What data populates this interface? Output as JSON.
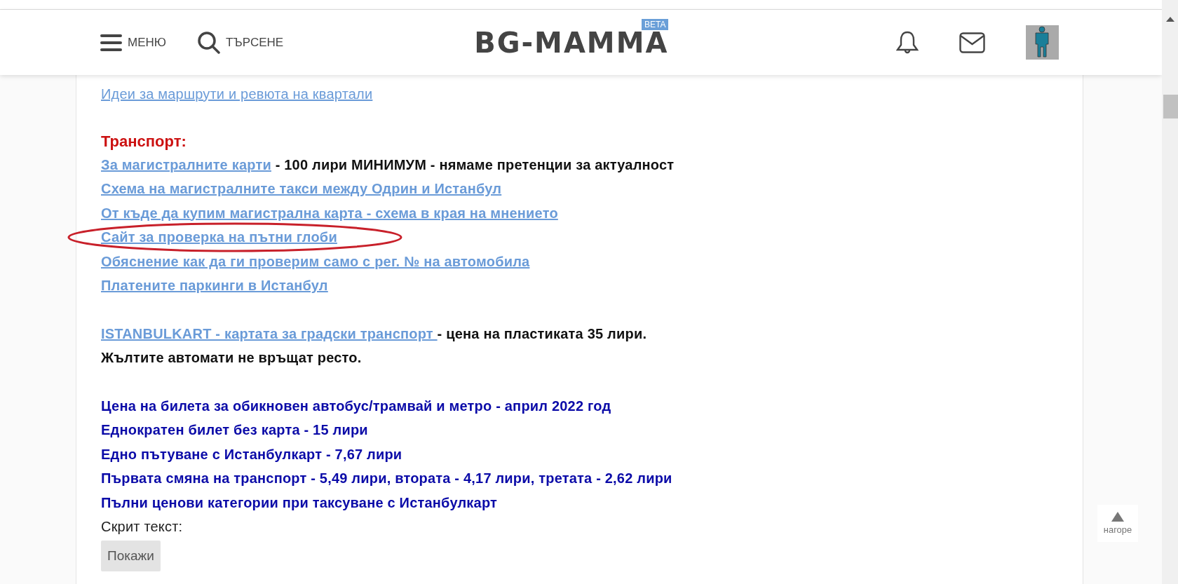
{
  "header": {
    "menu_label": "МЕНЮ",
    "search_label": "ТЪРСЕНЕ",
    "logo": "BG-MAMMA",
    "logo_badge": "BETA"
  },
  "content": {
    "blocks": [
      {
        "lines": [
          {
            "parts": [
              {
                "kind": "link",
                "text": "Идеи за маршрути и ревюта на квартали"
              }
            ]
          }
        ]
      },
      {
        "title": "Транспорт:",
        "lines": [
          {
            "parts": [
              {
                "kind": "link",
                "text": "За магистралните карти"
              },
              {
                "kind": "plain",
                "text": " - 100 лири МИНИМУМ - нямаме претенции за актуалност"
              }
            ]
          },
          {
            "parts": [
              {
                "kind": "link",
                "text": "Схема на магистралните такси между Одрин и Истанбул"
              }
            ]
          },
          {
            "parts": [
              {
                "kind": "link",
                "text": "От къде да купим магистрална карта - схема в края на мнението"
              }
            ]
          },
          {
            "circled": true,
            "parts": [
              {
                "kind": "link",
                "text": "Сайт за проверка на пътни глоби"
              }
            ]
          },
          {
            "parts": [
              {
                "kind": "link",
                "text": "Обяснение как да ги проверим само с рег. № на автомобила"
              }
            ]
          },
          {
            "parts": [
              {
                "kind": "link",
                "text": "Платените паркинги в Истанбул"
              }
            ]
          }
        ]
      },
      {
        "lines": [
          {
            "parts": [
              {
                "kind": "link",
                "text": "ISTANBULKART - картата за градски транспорт "
              },
              {
                "kind": "plain",
                "text": "- цена на пластиката 35 лири."
              }
            ]
          },
          {
            "parts": [
              {
                "kind": "plain",
                "text": "Жълтите автомати не връщат ресто."
              }
            ]
          }
        ]
      },
      {
        "lines": [
          {
            "parts": [
              {
                "kind": "blue",
                "text": "Цена на билета за обикновен автобус/трамвай и метро - април 2022 год"
              }
            ]
          },
          {
            "parts": [
              {
                "kind": "blue",
                "text": "Еднократен билет без карта - 15 лири"
              }
            ]
          },
          {
            "parts": [
              {
                "kind": "blue",
                "text": "Едно пътуване с Истанбулкарт - 7,67  лири"
              }
            ]
          },
          {
            "parts": [
              {
                "kind": "blue",
                "text": "Първата смяна на транспорт - 5,49 лири, втората - 4,17 лири, третата - 2,62 лири"
              }
            ]
          },
          {
            "parts": [
              {
                "kind": "blue",
                "text": "Пълни ценови категории при таксуване с Истанбулкарт"
              }
            ]
          },
          {
            "parts": [
              {
                "kind": "note",
                "text": "Скрит текст:"
              }
            ]
          }
        ]
      }
    ],
    "show_button": "Покажи"
  },
  "back_to_top": "нагоре"
}
